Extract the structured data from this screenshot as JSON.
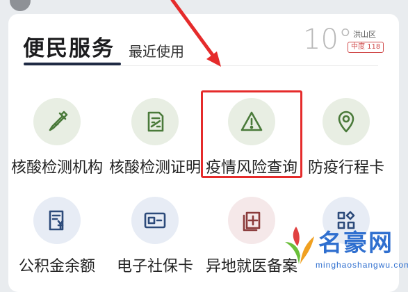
{
  "header": {
    "tab_main": "便民服务",
    "tab_recent": "最近使用"
  },
  "weather": {
    "temperature": "10°",
    "city": "洪山区",
    "air_quality": "中度 118"
  },
  "services": [
    {
      "label": "核酸检测机构",
      "icon": "dropper-icon"
    },
    {
      "label": "核酸检测证明",
      "icon": "certificate-icon"
    },
    {
      "label": "疫情风险查询",
      "icon": "warning-icon"
    },
    {
      "label": "防疫行程卡",
      "icon": "location-pin-icon"
    },
    {
      "label": "公积金余额",
      "icon": "fund-document-icon"
    },
    {
      "label": "电子社保卡",
      "icon": "id-card-icon"
    },
    {
      "label": "异地就医备案",
      "icon": "medical-record-icon"
    },
    {
      "label": "",
      "icon": "apps-grid-icon"
    }
  ],
  "watermark": {
    "title": "名豪网",
    "url": "minghaoshangwu.com"
  },
  "colors": {
    "accent_dark": "#1f2a44",
    "highlight_red": "#e52b2b",
    "icon_green": "#4a7a3a",
    "icon_blue": "#2c4a7a",
    "icon_pink": "#8a3a3a"
  }
}
